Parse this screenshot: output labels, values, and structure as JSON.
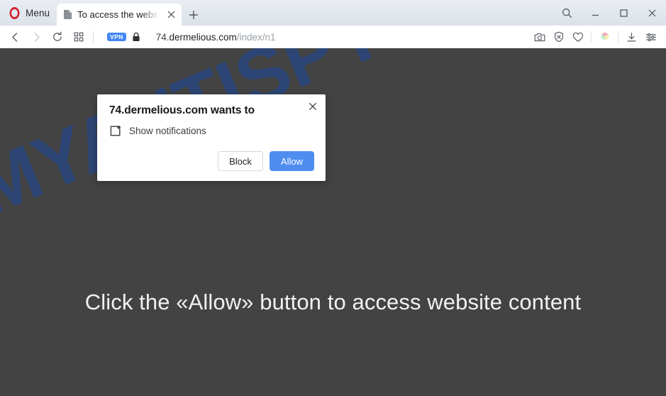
{
  "browser": {
    "menu_label": "Menu",
    "tab": {
      "title": "To access the website",
      "favicon_icon": "document-icon",
      "close_icon": "close-icon"
    },
    "new_tab_icon": "plus-icon",
    "window_controls": {
      "search_icon": "search-icon",
      "minimize_icon": "minimize-icon",
      "maximize_icon": "maximize-icon",
      "close_icon": "close-icon"
    },
    "nav": {
      "back_icon": "back-arrow-icon",
      "forward_icon": "forward-arrow-icon",
      "reload_icon": "reload-icon",
      "tab_grid_icon": "grid-icon"
    },
    "omnibox": {
      "vpn_badge": "VPN",
      "lock_icon": "padlock-icon",
      "url_prefix": "74.",
      "url_host": "dermelious.com",
      "url_path": "/index/n1",
      "full_url": "74.dermelious.com/index/n1"
    },
    "toolbar_right": {
      "snapshot_icon": "camera-icon",
      "adblock_icon": "shield-block-icon",
      "favorites_icon": "heart-icon",
      "cube_icon": "cube-icon",
      "downloads_icon": "download-icon",
      "easy_setup_icon": "sliders-icon"
    }
  },
  "page": {
    "watermark_text": "MYANTISPYWARE.COM",
    "headline": "Click the «Allow» button to access website content",
    "background_color": "#434343",
    "watermark_color": "#2d4675",
    "headline_color": "#f1f1f1"
  },
  "permission_dialog": {
    "title": "74.dermelious.com wants to",
    "permission_icon": "notification-badge-icon",
    "permission_label": "Show notifications",
    "close_icon": "close-icon",
    "block_label": "Block",
    "allow_label": "Allow",
    "allow_color": "#4d8ef0"
  }
}
